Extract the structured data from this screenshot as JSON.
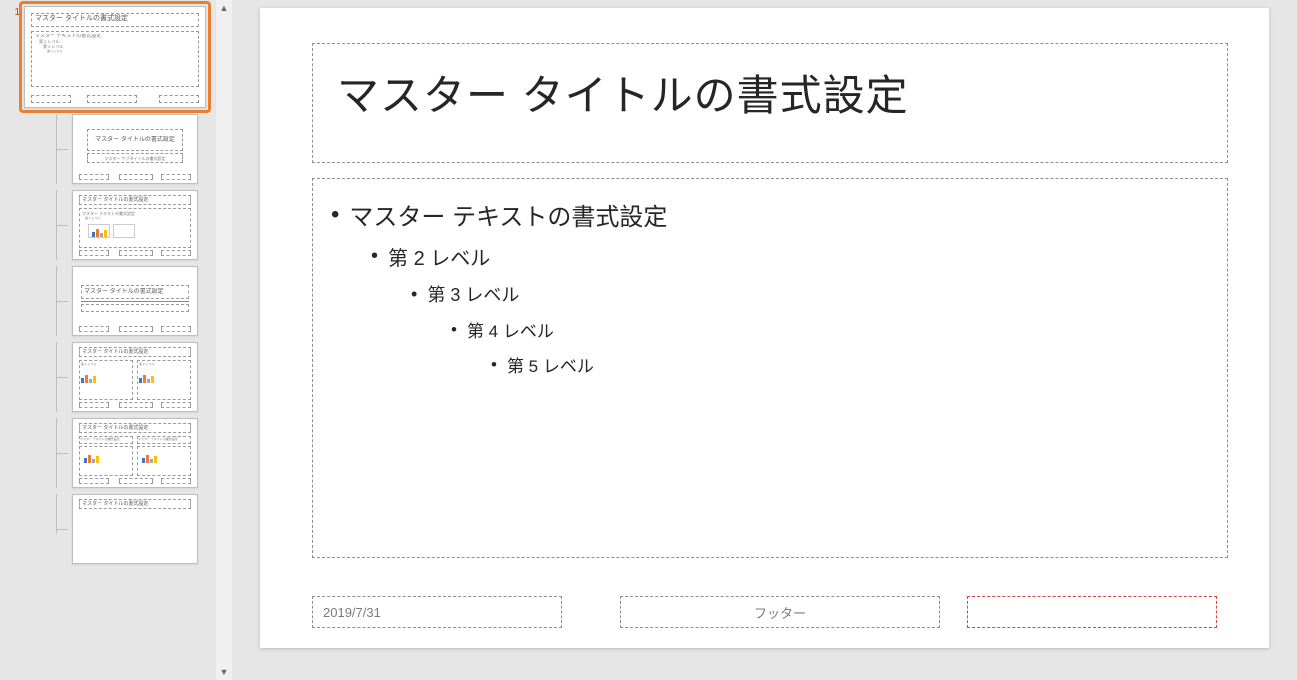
{
  "slide": {
    "title": "マスター タイトルの書式設定",
    "levels": {
      "l1": "マスター テキストの書式設定",
      "l2": "第 2 レベル",
      "l3": "第 3 レベル",
      "l4": "第 4 レベル",
      "l5": "第 5 レベル"
    },
    "date": "2019/7/31",
    "footer": "フッター",
    "slide_number": ""
  },
  "sidebar": {
    "master_index": "1",
    "thumbs": {
      "master_title": "マスター タイトルの書式設定",
      "master_l1": "マスター テキストの書式設定",
      "master_l2": "第 2 レベル",
      "master_l3": "第 3 レベル",
      "master_l4": "第 4 レベル",
      "layout_title_sub": "マスター タイトルの書式設定",
      "layout_subtitle": "マスター サブタイトルの書式設定",
      "layout_content_title": "マスター タイトルの書式設定",
      "layout_section_title": "マスター タイトルの書式設定",
      "layout_two_title": "マスター タイトルの書式設定",
      "layout_cmp_title": "マスター タイトルの書式設定",
      "layout_cmp_h1": "マスター テキストの書式設定",
      "layout_cmp_h2": "マスター テキストの書式設定",
      "layout_blank_title": "マスター タイトルの書式設定"
    }
  }
}
